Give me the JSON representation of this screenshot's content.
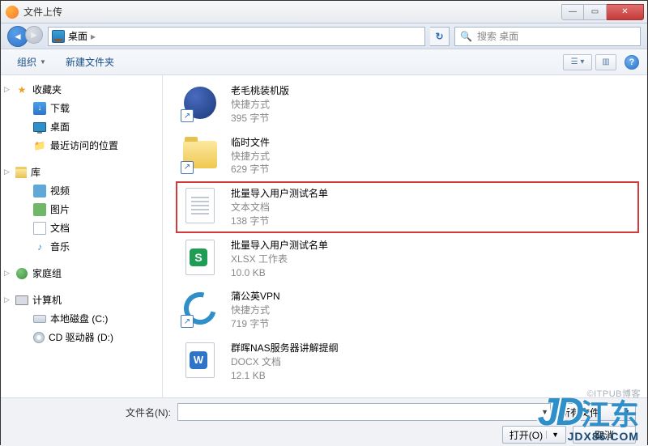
{
  "window": {
    "title": "文件上传"
  },
  "nav": {
    "location": "桌面",
    "search_placeholder": "搜索 桌面"
  },
  "toolbar": {
    "organize": "组织",
    "new_folder": "新建文件夹"
  },
  "sidebar": {
    "favorites": {
      "label": "收藏夹",
      "items": [
        {
          "label": "下载",
          "icon": "download"
        },
        {
          "label": "桌面",
          "icon": "desktop"
        },
        {
          "label": "最近访问的位置",
          "icon": "recent"
        }
      ]
    },
    "libraries": {
      "label": "库",
      "items": [
        {
          "label": "视频",
          "icon": "video"
        },
        {
          "label": "图片",
          "icon": "picture"
        },
        {
          "label": "文档",
          "icon": "document"
        },
        {
          "label": "音乐",
          "icon": "music"
        }
      ]
    },
    "homegroup": {
      "label": "家庭组"
    },
    "computer": {
      "label": "计算机",
      "items": [
        {
          "label": "本地磁盘 (C:)",
          "icon": "drive"
        },
        {
          "label": "CD 驱动器 (D:)",
          "icon": "cd"
        }
      ]
    }
  },
  "files": [
    {
      "name": "老毛桃装机版",
      "type": "快捷方式",
      "size": "395 字节",
      "icon": "plum",
      "shortcut": true
    },
    {
      "name": "临时文件",
      "type": "快捷方式",
      "size": "629 字节",
      "icon": "folder",
      "shortcut": true
    },
    {
      "name": "批量导入用户测试名单",
      "type": "文本文档",
      "size": "138 字节",
      "icon": "txt",
      "highlight": true
    },
    {
      "name": "批量导入用户测试名单",
      "type": "XLSX 工作表",
      "size": "10.0 KB",
      "icon": "xlsx"
    },
    {
      "name": "蒲公英VPN",
      "type": "快捷方式",
      "size": "719 字节",
      "icon": "vpn",
      "shortcut": true
    },
    {
      "name": "群晖NAS服务器讲解提纲",
      "type": "DOCX 文档",
      "size": "12.1 KB",
      "icon": "docx"
    }
  ],
  "footer": {
    "filename_label": "文件名(N):",
    "filter": "所有文件",
    "open": "打开(O)",
    "cancel": "取消"
  },
  "watermark": "©ITPUB博客",
  "logo": {
    "jd": "JD",
    "cn": "江东",
    "sub": "JDX86.COM"
  }
}
